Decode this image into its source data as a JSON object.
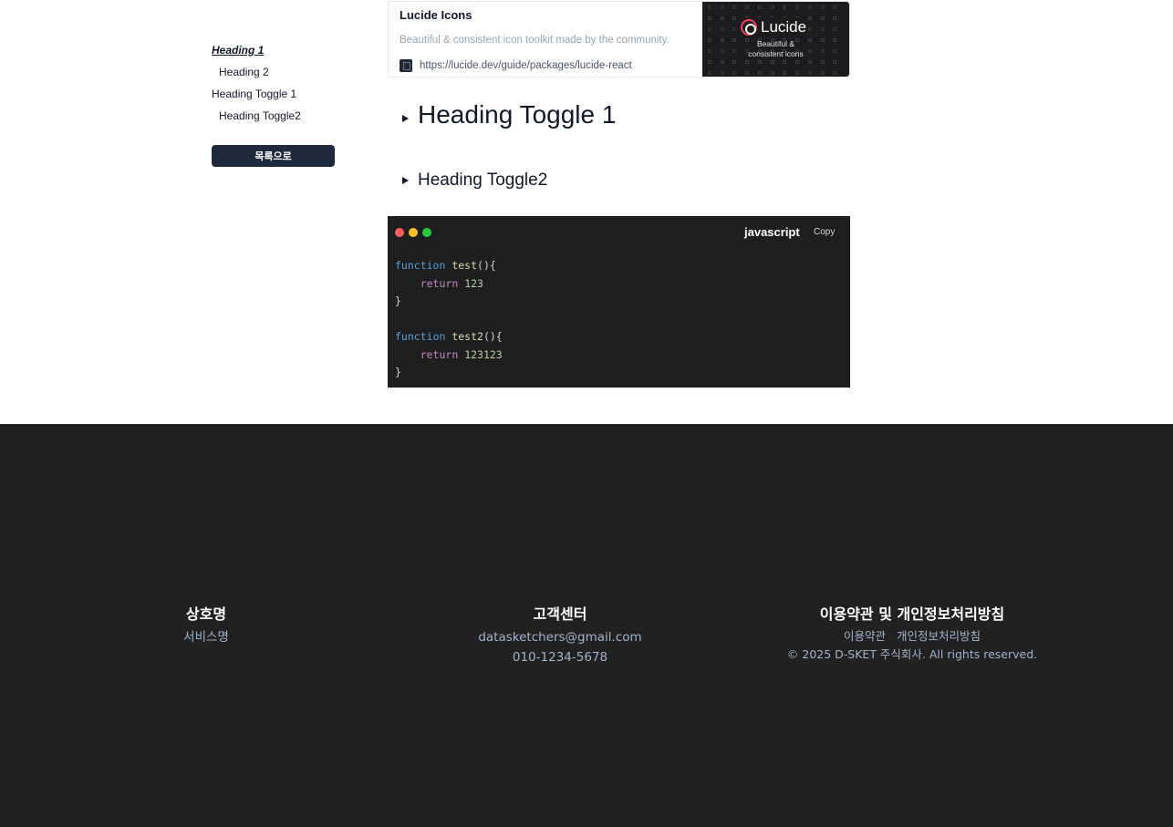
{
  "toc": {
    "items": [
      {
        "label": "Heading 1"
      },
      {
        "label": "Heading 2"
      },
      {
        "label": "Heading Toggle 1"
      },
      {
        "label": "Heading Toggle2"
      }
    ],
    "back_button": "목록으로"
  },
  "bookmark": {
    "title": "Lucide Icons",
    "description": "Beautiful & consistent icon toolkit made by the community.",
    "url": "https://lucide.dev/guide/packages/lucide-react",
    "image_brand": "Lucide",
    "image_tagline_line1": "Beautiful &",
    "image_tagline_line2": "consistent icons"
  },
  "toggles": {
    "toggle1": "Heading Toggle 1",
    "toggle2": "Heading Toggle2"
  },
  "code_block": {
    "language": "javascript",
    "copy_label": "Copy",
    "dot_colors": [
      "#ff5f56",
      "#ffbd2e",
      "#27c93f"
    ],
    "lines": [
      [
        {
          "t": "function",
          "c": "kw"
        },
        {
          "t": " "
        },
        {
          "t": "test",
          "c": "fn"
        },
        {
          "t": "(){"
        }
      ],
      [
        {
          "t": "    "
        },
        {
          "t": "return",
          "c": "rt"
        },
        {
          "t": " "
        },
        {
          "t": "123",
          "c": "num"
        }
      ],
      [
        {
          "t": "}"
        }
      ],
      [
        {
          "t": ""
        }
      ],
      [
        {
          "t": "function",
          "c": "kw"
        },
        {
          "t": " "
        },
        {
          "t": "test2",
          "c": "fn"
        },
        {
          "t": "(){"
        }
      ],
      [
        {
          "t": "    "
        },
        {
          "t": "return",
          "c": "rt"
        },
        {
          "t": " "
        },
        {
          "t": "123123",
          "c": "num"
        }
      ],
      [
        {
          "t": "}"
        }
      ]
    ]
  },
  "footer": {
    "company": {
      "heading": "상호명",
      "name": "서비스명"
    },
    "support": {
      "heading": "고객센터",
      "email": "datasketchers@gmail.com",
      "phone": "010-1234-5678"
    },
    "legal": {
      "heading": "이용약관 및 개인정보처리방침",
      "terms_link": "이용약관",
      "privacy_link": "개인정보처리방침",
      "copyright": "© 2025 D-SKET 주식회사. All rights reserved."
    }
  }
}
